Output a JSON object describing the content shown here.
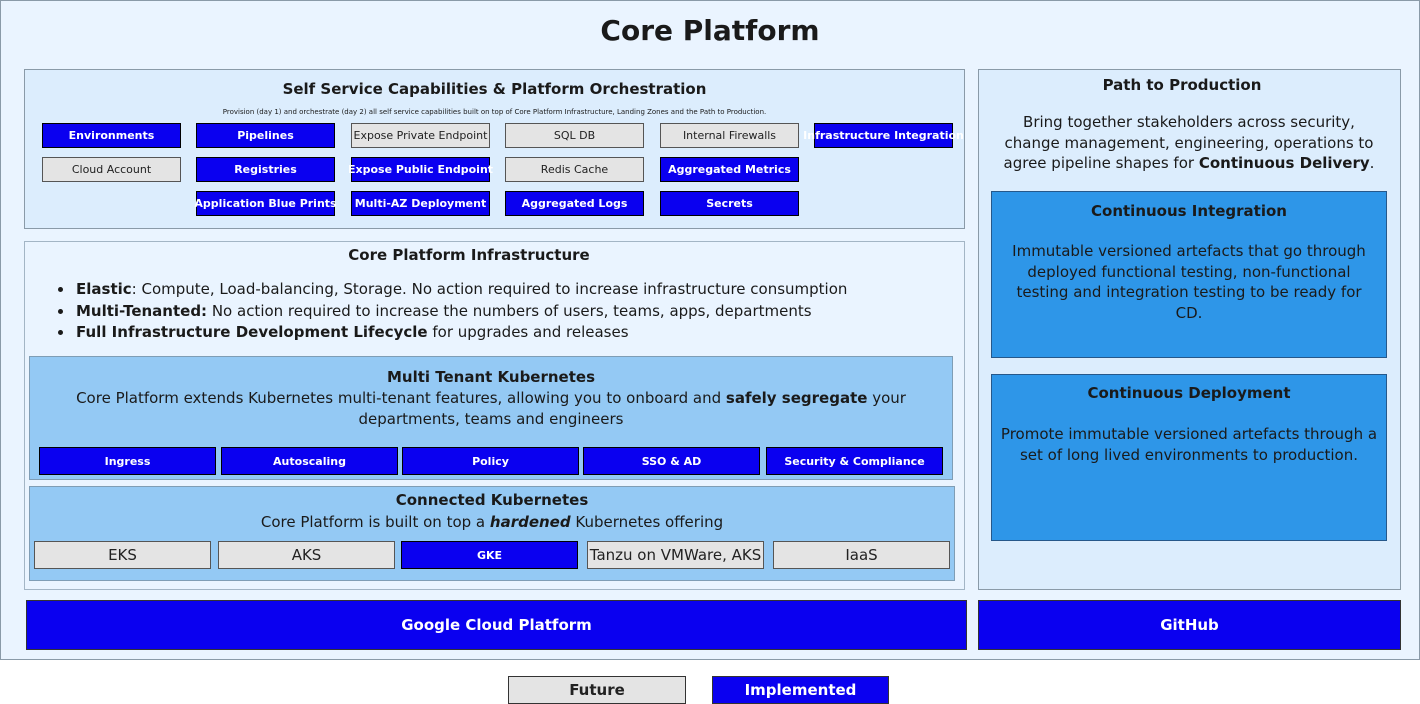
{
  "title": "Core Platform",
  "self_service": {
    "heading": "Self Service Capabilities & Platform Orchestration",
    "subtitle": "Provision (day 1) and orchestrate (day 2) all self service capabilities built on top of Core Platform Infrastructure, Landing Zones and the Path to Production.",
    "items": [
      {
        "label": "Environments",
        "status": "implemented"
      },
      {
        "label": "Pipelines",
        "status": "implemented"
      },
      {
        "label": "Expose Private Endpoint",
        "status": "future"
      },
      {
        "label": "SQL DB",
        "status": "future"
      },
      {
        "label": "Internal Firewalls",
        "status": "future"
      },
      {
        "label": "Infrastructure Integration",
        "status": "implemented"
      },
      {
        "label": "Cloud Account",
        "status": "future"
      },
      {
        "label": "Registries",
        "status": "implemented"
      },
      {
        "label": "Expose Public Endpoint",
        "status": "implemented"
      },
      {
        "label": "Redis Cache",
        "status": "future"
      },
      {
        "label": "Aggregated Metrics",
        "status": "implemented"
      },
      {
        "label": "Application Blue Prints",
        "status": "implemented"
      },
      {
        "label": "Multi-AZ Deployment",
        "status": "implemented"
      },
      {
        "label": "Aggregated Logs",
        "status": "implemented"
      },
      {
        "label": "Secrets",
        "status": "implemented"
      }
    ]
  },
  "infrastructure": {
    "heading": "Core Platform Infrastructure",
    "bullets": [
      {
        "bold": "Elastic",
        "text": ": Compute, Load-balancing, Storage. No action required to increase infrastructure consumption"
      },
      {
        "bold": "Multi-Tenanted:",
        "text": " No action required to increase the numbers of users, teams, apps, departments"
      },
      {
        "bold": "Full Infrastructure Development Lifecycle",
        "text": " for upgrades and releases"
      }
    ]
  },
  "multi_tenant": {
    "heading": "Multi Tenant Kubernetes",
    "text_before": "Core Platform extends Kubernetes multi-tenant features, allowing you to onboard and ",
    "text_bold": "safely segregate",
    "text_after": " your departments, teams and engineers",
    "items": [
      {
        "label": "Ingress",
        "status": "implemented"
      },
      {
        "label": "Autoscaling",
        "status": "implemented"
      },
      {
        "label": "Policy",
        "status": "implemented"
      },
      {
        "label": "SSO & AD",
        "status": "implemented"
      },
      {
        "label": "Security & Compliance",
        "status": "implemented"
      }
    ]
  },
  "connected": {
    "heading": "Connected Kubernetes",
    "text_before": "Core Platform is built on top a ",
    "text_bold_italic": "hardened",
    "text_after": " Kubernetes offering",
    "items": [
      {
        "label": "EKS",
        "status": "future"
      },
      {
        "label": "AKS",
        "status": "future"
      },
      {
        "label": "GKE",
        "status": "implemented"
      },
      {
        "label": "Tanzu on VMWare, AKS",
        "status": "future"
      },
      {
        "label": "IaaS",
        "status": "future"
      }
    ]
  },
  "path_to_production": {
    "heading": "Path to Production",
    "text_before": "Bring together stakeholders across security, change management, engineering, operations to agree pipeline shapes for ",
    "text_bold": "Continuous Delivery",
    "text_after": ".",
    "ci": {
      "heading": "Continuous Integration",
      "text": "Immutable versioned artefacts that go through deployed functional testing, non-functional testing and integration testing to be ready for CD."
    },
    "cd": {
      "heading": "Continuous Deployment",
      "text": "Promote immutable versioned artefacts through a set of long lived environments to production."
    }
  },
  "footer_bars": {
    "gcp": "Google Cloud Platform",
    "github": "GitHub"
  },
  "legend": {
    "future": "Future",
    "implemented": "Implemented"
  },
  "colors": {
    "implemented": "#0a00f0",
    "future": "#e4e4e4",
    "background": "#eaf4ff",
    "kubernetes": "#94c9f4",
    "ci_cd": "#2e96e8"
  }
}
